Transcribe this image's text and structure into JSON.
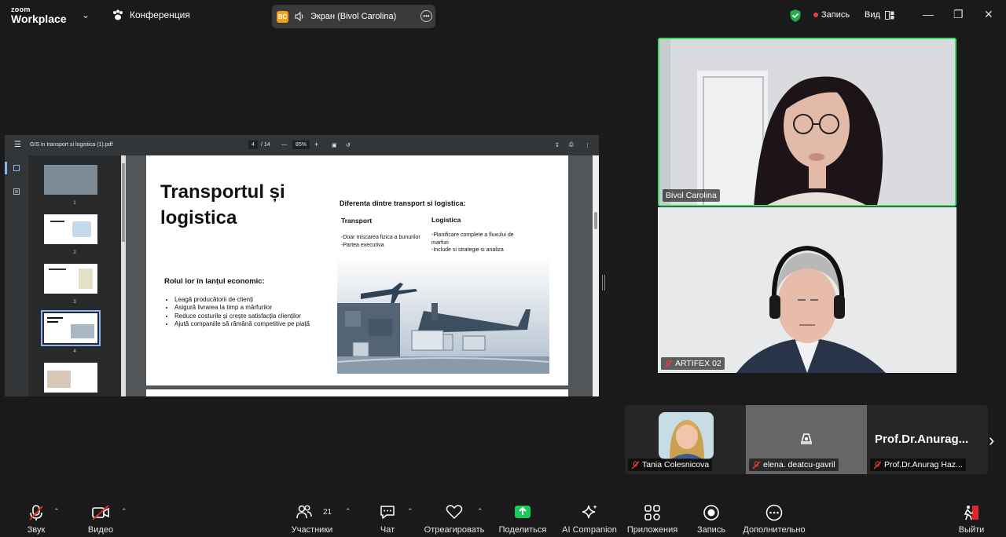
{
  "app": {
    "logo_line1": "zoom",
    "logo_line2": "Workplace",
    "meeting_label": "Конференция"
  },
  "share_pill": {
    "badge": "BC",
    "label": "Экран (Bivol Carolina)"
  },
  "top_right": {
    "record_label": "Запись",
    "view_label": "Вид"
  },
  "pdf": {
    "filename": "GIS in transport si logistica (1).pdf",
    "current_page": "4",
    "total_pages": "/ 14",
    "zoom": "85%",
    "thumbnails": [
      "1",
      "2",
      "3",
      "4"
    ],
    "slide": {
      "title": "Transportul și logistica",
      "diff_heading": "Diferenta dintre transport si logistica:",
      "col1_header": "Transport",
      "col2_header": "Logistica",
      "col1_text": "-Doar miscarea fizica a bunurilor\n-Partea executiva",
      "col2_text": "-Planificare complete a fluxului de marfuri\n-Include si strategie si analiza",
      "role_heading": "Rolul lor în lanțul economic:",
      "bullets": [
        "Leagă producătorii de clienți",
        "Asigură livrarea la timp a mărfurilor",
        "Reduce costurile și crește satisfacția clienților",
        "Ajută companiile să rămână competitive pe piață"
      ]
    }
  },
  "participants": {
    "main1": "Bivol Carolina",
    "main2": "ARTIFEX 02",
    "strip": [
      {
        "name": "Tania Colesnicova"
      },
      {
        "name": "elena. deatcu-gavril"
      },
      {
        "name": "Prof.Dr.Anurag Haz...",
        "display": "Prof.Dr.Anurag..."
      }
    ]
  },
  "toolbar": {
    "audio": "Звук",
    "video": "Видео",
    "participants": "Участники",
    "participants_count": "21",
    "chat": "Чат",
    "react": "Отреагировать",
    "share": "Поделиться",
    "ai": "AI Companion",
    "apps": "Приложения",
    "record": "Запись",
    "more": "Дополнительно",
    "leave": "Выйти"
  },
  "colors": {
    "active_speaker": "#3fd96b",
    "share_green": "#19c95a",
    "leave_red": "#e02828",
    "record_dot": "#f13b3b"
  }
}
